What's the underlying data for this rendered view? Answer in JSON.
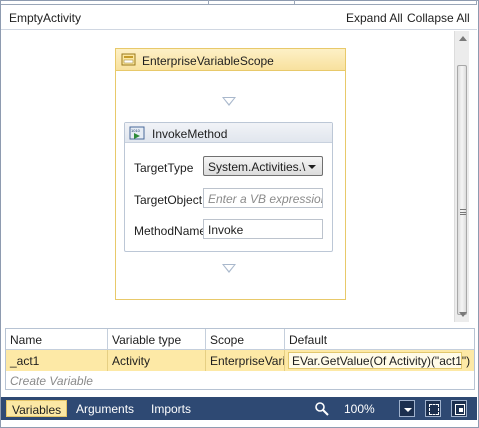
{
  "header": {
    "title": "EmptyActivity",
    "expand_all": "Expand All",
    "collapse_all": "Collapse All"
  },
  "designer": {
    "scope": {
      "title": "EnterpriseVariableScope",
      "icon": "scope-icon"
    },
    "invoke_method": {
      "title": "InvokeMethod",
      "icon": "invoke-method-icon",
      "target_type_label": "TargetType",
      "target_type_value": "System.Activities.\\",
      "target_object_label": "TargetObject",
      "target_object_placeholder": "Enter a VB expression",
      "method_name_label": "MethodName",
      "method_name_value": "Invoke"
    }
  },
  "variables_grid": {
    "columns": [
      "Name",
      "Variable type",
      "Scope",
      "Default"
    ],
    "rows": [
      {
        "name": "_act1",
        "variable_type": "Activity",
        "scope": "EnterpriseVariableScope",
        "default": "EVar.GetValue(Of Activity)(\"act1\")"
      }
    ],
    "create_variable": "Create Variable"
  },
  "bottom_bar": {
    "tabs": [
      "Variables",
      "Arguments",
      "Imports"
    ],
    "active_tab": "Variables",
    "zoom": "100%"
  },
  "colors": {
    "bottom_bar_bg": "#2e4973",
    "active_tab_bg": "#fbe8a4",
    "scope_header": "#f8e19e",
    "selected_row": "#fde9a6"
  }
}
